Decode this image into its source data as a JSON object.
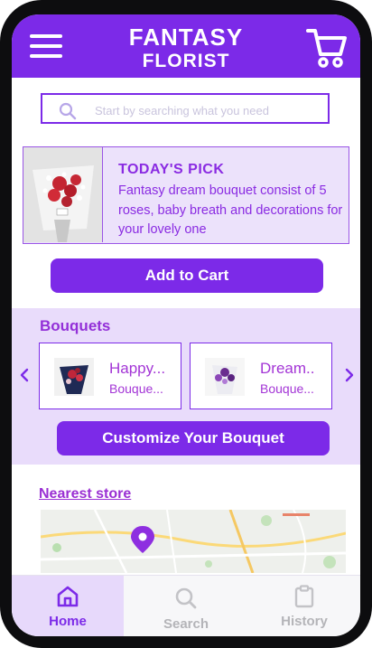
{
  "header": {
    "brand_line1": "FANTASY",
    "brand_line2": "FLORIST",
    "menu_icon": "hamburger-menu-icon",
    "cart_icon": "shopping-cart-icon"
  },
  "search": {
    "placeholder": "Start by searching what you need",
    "icon": "search-icon"
  },
  "todays_pick": {
    "title": "TODAY'S PICK",
    "description": "Fantasy dream bouquet consist of 5 roses, baby breath and decorations for your lovely one"
  },
  "add_to_cart_label": "Add to Cart",
  "bouquets": {
    "title": "Bouquets",
    "items": [
      {
        "name": "Happy...",
        "subtitle": "Bouque..."
      },
      {
        "name": "Dream..",
        "subtitle": "Bouque..."
      }
    ],
    "prev_icon": "chevron-left-icon",
    "next_icon": "chevron-right-icon"
  },
  "customize_label": "Customize Your Bouquet",
  "nearest_store_label": "Nearest store",
  "nav": {
    "items": [
      {
        "label": "Home",
        "icon": "home-icon",
        "active": true
      },
      {
        "label": "Search",
        "icon": "search-icon",
        "active": false
      },
      {
        "label": "History",
        "icon": "clipboard-icon",
        "active": false
      }
    ]
  },
  "colors": {
    "primary": "#7c2ae8",
    "light_purple": "#e9dcfb",
    "accent_text": "#9330d8"
  }
}
